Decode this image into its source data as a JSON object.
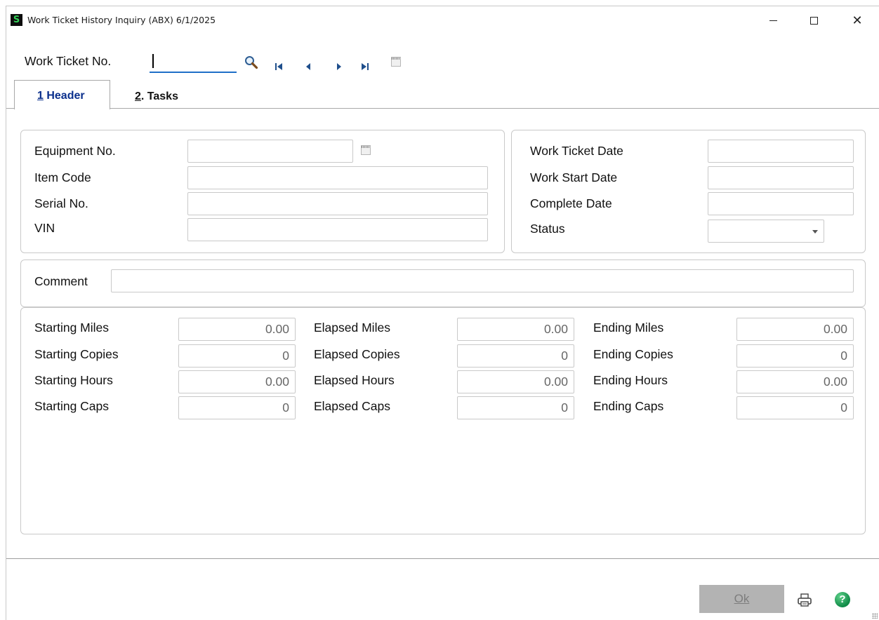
{
  "window": {
    "title": "Work Ticket History Inquiry (ABX) 6/1/2025",
    "app_icon_letter": "S",
    "close_glyph": "✕"
  },
  "lookup": {
    "label": "Work Ticket No.",
    "value": ""
  },
  "tabs": [
    {
      "number": "1",
      "label": " Header",
      "active": true
    },
    {
      "number": "2",
      "label": ". Tasks",
      "active": false
    }
  ],
  "header": {
    "equipment_no": {
      "label": "Equipment No.",
      "value": ""
    },
    "item_code": {
      "label": "Item Code",
      "value": ""
    },
    "serial_no": {
      "label": "Serial No.",
      "value": ""
    },
    "vin": {
      "label": "VIN",
      "value": ""
    },
    "work_ticket_date": {
      "label": "Work Ticket Date",
      "value": ""
    },
    "work_start_date": {
      "label": "Work Start Date",
      "value": ""
    },
    "complete_date": {
      "label": "Complete Date",
      "value": ""
    },
    "status": {
      "label": "Status",
      "value": ""
    }
  },
  "comment": {
    "label": "Comment",
    "value": ""
  },
  "meters": {
    "starting": [
      {
        "label": "Starting Miles",
        "value": "0.00"
      },
      {
        "label": "Starting Copies",
        "value": "0"
      },
      {
        "label": "Starting Hours",
        "value": "0.00"
      },
      {
        "label": "Starting Caps",
        "value": "0"
      }
    ],
    "elapsed": [
      {
        "label": "Elapsed Miles",
        "value": "0.00"
      },
      {
        "label": "Elapsed Copies",
        "value": "0"
      },
      {
        "label": "Elapsed Hours",
        "value": "0.00"
      },
      {
        "label": "Elapsed Caps",
        "value": "0"
      }
    ],
    "ending": [
      {
        "label": "Ending Miles",
        "value": "0.00"
      },
      {
        "label": "Ending Copies",
        "value": "0"
      },
      {
        "label": "Ending Hours",
        "value": "0.00"
      },
      {
        "label": "Ending Caps",
        "value": "0"
      }
    ]
  },
  "footer": {
    "ok_label": "Ok",
    "help_glyph": "?"
  },
  "colors": {
    "tab_active_text": "#0a2f8c",
    "focus_underline": "#1f6fc7",
    "help_green": "#0f8a47",
    "ok_disabled_bg": "#b3b3b3"
  },
  "icons": [
    "app-icon",
    "minimize-icon",
    "maximize-icon",
    "close-icon",
    "search-icon",
    "first-record-icon",
    "previous-record-icon",
    "next-record-icon",
    "last-record-icon",
    "notes-icon",
    "calendar-icon",
    "dropdown-arrow-icon",
    "printer-icon",
    "help-icon",
    "resize-grip-icon"
  ]
}
